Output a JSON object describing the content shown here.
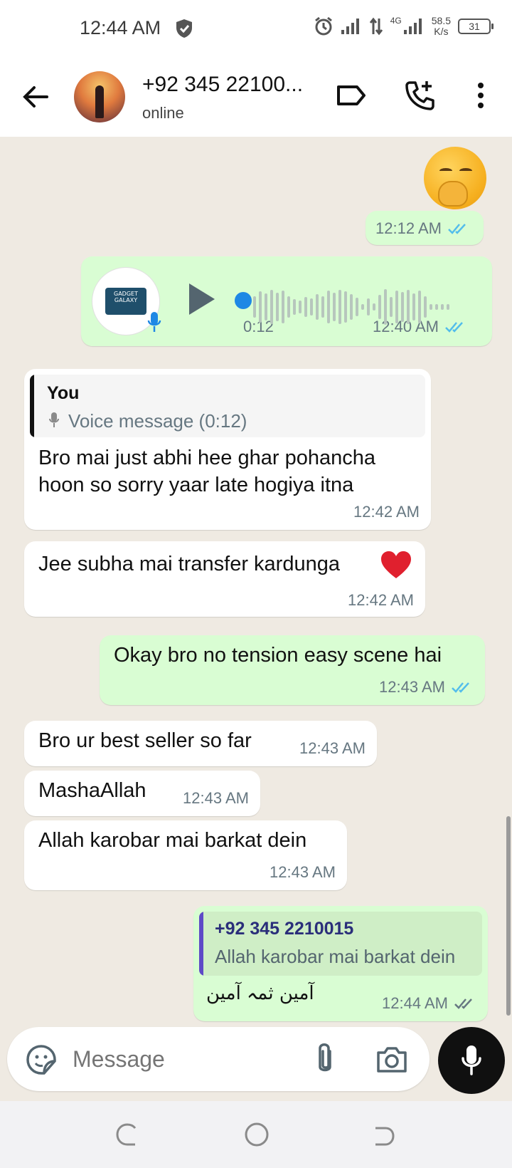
{
  "status_bar": {
    "time": "12:44 AM",
    "net_speed_value": "58.5",
    "net_speed_unit": "K/s",
    "network_type": "4G",
    "battery": "31"
  },
  "header": {
    "contact_name": "+92 345 22100...",
    "contact_status": "online"
  },
  "messages": {
    "m1": {
      "time": "12:12 AM"
    },
    "m2": {
      "duration": "0:12",
      "time": "12:40 AM",
      "avatar_text_1": "GADGET",
      "avatar_text_2": "GALAXY"
    },
    "m3": {
      "quote_sender": "You",
      "quote_text": "Voice message (0:12)",
      "text": "Bro mai just abhi hee ghar pohancha hoon so sorry yaar late hogiya itna",
      "time": "12:42 AM"
    },
    "m4": {
      "text": "Jee subha mai transfer kardunga",
      "time": "12:42 AM"
    },
    "m5": {
      "text": "Okay bro no tension easy scene hai",
      "time": "12:43 AM"
    },
    "m6": {
      "text": "Bro ur best seller so far",
      "time": "12:43 AM"
    },
    "m7": {
      "text": "MashaAllah",
      "time": "12:43 AM"
    },
    "m8": {
      "text": "Allah karobar mai barkat dein",
      "time": "12:43 AM"
    },
    "m9": {
      "quote_sender": "+92 345 2210015",
      "quote_text": "Allah karobar mai barkat dein",
      "text": "آمین ثمہ آمین",
      "time": "12:44 AM"
    }
  },
  "input": {
    "placeholder": "Message"
  },
  "colors": {
    "outgoing_bubble": "#d9fdd3",
    "incoming_bubble": "#ffffff",
    "read_ticks": "#53bdeb",
    "chat_background": "#efeae2"
  }
}
